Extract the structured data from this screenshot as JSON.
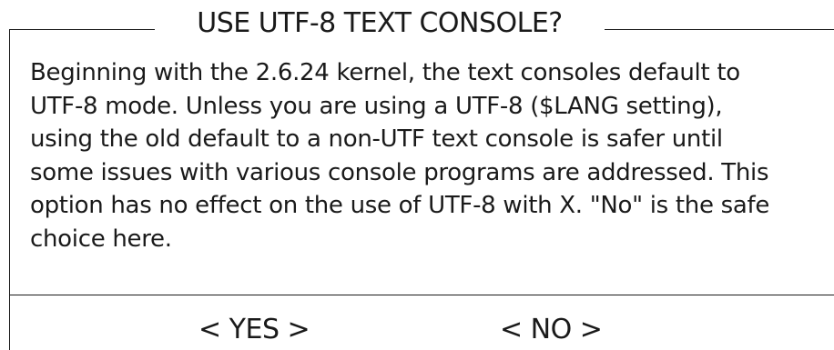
{
  "dialog": {
    "title": "USE UTF-8 TEXT CONSOLE?",
    "body_lines": [
      "Beginning with the 2.6.24 kernel, the text consoles default to",
      "UTF-8 mode. Unless you are using a UTF-8 ($LANG setting),",
      "using the old default to a non-UTF text console is safer until",
      "some issues with various console programs are addressed. This",
      "option has no effect on the use of UTF-8 with X. \"No\" is the safe",
      "choice here."
    ],
    "buttons": {
      "yes_label": "< YES >",
      "no_label": "< NO >"
    }
  },
  "colors": {
    "background": "#ffffff",
    "foreground": "#1a1a1a"
  }
}
